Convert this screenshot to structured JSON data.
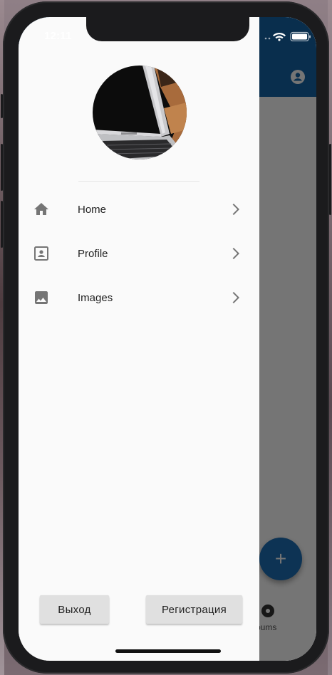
{
  "status_bar": {
    "time": "12:11"
  },
  "app": {
    "bottom_nav_label": "bums",
    "fab_label": "+",
    "bar_color": "#1565a8",
    "fab_color": "#1e6fb8"
  },
  "drawer": {
    "avatar_alt": "laptop photo",
    "menu": [
      {
        "label": "Home",
        "icon": "home-icon"
      },
      {
        "label": "Profile",
        "icon": "contact-card-icon"
      },
      {
        "label": "Images",
        "icon": "image-icon"
      }
    ],
    "buttons": {
      "logout": "Выход",
      "register": "Регистрация"
    }
  }
}
